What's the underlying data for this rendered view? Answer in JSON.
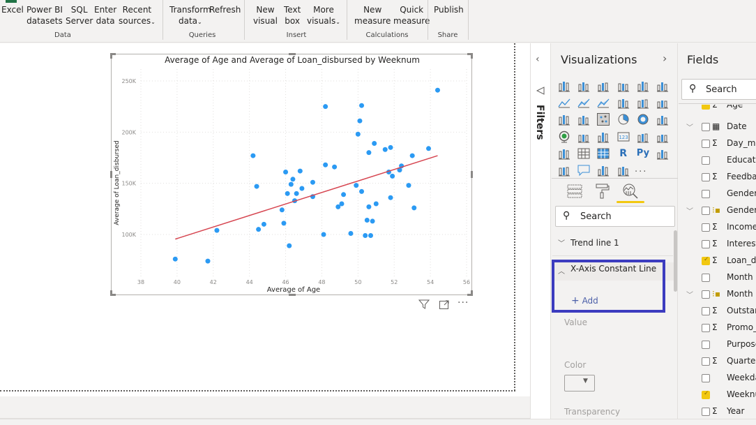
{
  "ribbon": {
    "buttons": [
      {
        "id": "excel",
        "line1": "Excel",
        "line2": ""
      },
      {
        "id": "power-bi-datasets",
        "line1": "Power BI",
        "line2": "datasets"
      },
      {
        "id": "sql-server",
        "line1": "SQL",
        "line2": "Server"
      },
      {
        "id": "enter-data",
        "line1": "Enter",
        "line2": "data"
      },
      {
        "id": "recent-sources",
        "line1": "Recent",
        "line2": "sources"
      },
      {
        "id": "transform-data",
        "line1": "Transform",
        "line2": "data"
      },
      {
        "id": "refresh",
        "line1": "Refresh",
        "line2": ""
      },
      {
        "id": "new-visual",
        "line1": "New",
        "line2": "visual"
      },
      {
        "id": "text-box",
        "line1": "Text",
        "line2": "box"
      },
      {
        "id": "more-visuals",
        "line1": "More",
        "line2": "visuals"
      },
      {
        "id": "new-measure",
        "line1": "New",
        "line2": "measure"
      },
      {
        "id": "quick-measure",
        "line1": "Quick",
        "line2": "measure"
      },
      {
        "id": "publish",
        "line1": "Publish",
        "line2": ""
      }
    ],
    "groups": [
      "Data",
      "Queries",
      "Insert",
      "Calculations",
      "Share"
    ]
  },
  "visual": {
    "footer_icons": [
      "filter-icon",
      "focus-mode-icon",
      "more-options-icon"
    ]
  },
  "chart_data": {
    "type": "scatter",
    "title": "Average of Age and Average of Loan_disbursed by Weeknum",
    "xlabel": "Average of Age",
    "ylabel": "Average of Loan_disbursed",
    "xlim": [
      38,
      56
    ],
    "ylim": [
      65000,
      262000
    ],
    "x_ticks": [
      38,
      40,
      42,
      44,
      46,
      48,
      50,
      52,
      54,
      56
    ],
    "y_ticks": [
      100000,
      150000,
      200000,
      250000
    ],
    "y_tick_labels": [
      "100K",
      "150K",
      "200K",
      "250K"
    ],
    "grid": true,
    "point_color": "#2b9af3",
    "trend_line": {
      "color": "#d64550",
      "from": [
        39.9,
        95500
      ],
      "to": [
        54.4,
        177000
      ]
    },
    "points": [
      [
        39.9,
        76000
      ],
      [
        41.7,
        74000
      ],
      [
        42.2,
        104000
      ],
      [
        44.2,
        177000
      ],
      [
        44.4,
        147000
      ],
      [
        44.5,
        105000
      ],
      [
        44.8,
        110000
      ],
      [
        45.8,
        124000
      ],
      [
        45.9,
        111000
      ],
      [
        46.0,
        161000
      ],
      [
        46.1,
        140000
      ],
      [
        46.2,
        89000
      ],
      [
        46.3,
        149000
      ],
      [
        46.4,
        154000
      ],
      [
        46.5,
        133000
      ],
      [
        46.6,
        140000
      ],
      [
        46.8,
        162000
      ],
      [
        46.9,
        145000
      ],
      [
        47.5,
        151000
      ],
      [
        47.5,
        137000
      ],
      [
        48.1,
        100000
      ],
      [
        48.2,
        225000
      ],
      [
        48.2,
        168000
      ],
      [
        48.7,
        166000
      ],
      [
        48.9,
        127000
      ],
      [
        49.1,
        130000
      ],
      [
        49.2,
        139000
      ],
      [
        49.6,
        101000
      ],
      [
        49.9,
        148000
      ],
      [
        50.0,
        198000
      ],
      [
        50.1,
        211000
      ],
      [
        50.2,
        226000
      ],
      [
        50.2,
        142000
      ],
      [
        50.4,
        99000
      ],
      [
        50.5,
        114000
      ],
      [
        50.6,
        180000
      ],
      [
        50.6,
        127000
      ],
      [
        50.7,
        99000
      ],
      [
        50.8,
        113000
      ],
      [
        50.9,
        189000
      ],
      [
        51.0,
        130000
      ],
      [
        51.5,
        183000
      ],
      [
        51.7,
        161000
      ],
      [
        51.8,
        185000
      ],
      [
        51.8,
        136000
      ],
      [
        51.9,
        157000
      ],
      [
        52.3,
        163000
      ],
      [
        52.4,
        167000
      ],
      [
        52.8,
        148000
      ],
      [
        53.0,
        177000
      ],
      [
        53.1,
        126000
      ],
      [
        53.9,
        184000
      ],
      [
        54.4,
        241000
      ]
    ]
  },
  "filters": {
    "label": "Filters"
  },
  "visualizations": {
    "title": "Visualizations",
    "search_placeholder": "Search",
    "more_label": "...",
    "sections": [
      {
        "label": "Trend line",
        "count": "1",
        "expanded": false
      },
      {
        "label": "X-Axis Constant Line",
        "expanded": true
      }
    ],
    "add_label": "Add",
    "value_label": "Value",
    "color_label": "Color",
    "transparency_label": "Transparency",
    "active_tab_color": "#f2c811"
  },
  "fields": {
    "title": "Fields",
    "search_placeholder": "Search",
    "items": [
      {
        "name": "Age",
        "type": "sigma",
        "checked": true,
        "expandable": false
      },
      {
        "name": "Date",
        "type": "calendar",
        "checked": false,
        "expandable": true
      },
      {
        "name": "Day_month",
        "type": "sigma",
        "checked": false,
        "expandable": false
      },
      {
        "name": "Education",
        "type": "",
        "checked": false,
        "expandable": false
      },
      {
        "name": "Feedback",
        "type": "sigma",
        "checked": false,
        "expandable": false
      },
      {
        "name": "Gender",
        "type": "",
        "checked": false,
        "expandable": false
      },
      {
        "name": "Gender Hierarchy",
        "type": "hierarchy",
        "checked": false,
        "expandable": true
      },
      {
        "name": "Income",
        "type": "sigma",
        "checked": false,
        "expandable": false
      },
      {
        "name": "Interest_rate",
        "type": "sigma",
        "checked": false,
        "expandable": false
      },
      {
        "name": "Loan_disbursed",
        "type": "sigma",
        "checked": true,
        "expandable": false
      },
      {
        "name": "Month",
        "type": "",
        "checked": false,
        "expandable": false
      },
      {
        "name": "Month Hierarchy",
        "type": "hierarchy",
        "checked": false,
        "expandable": true
      },
      {
        "name": "Outstanding",
        "type": "sigma",
        "checked": false,
        "expandable": false
      },
      {
        "name": "Promo_",
        "type": "sigma",
        "checked": false,
        "expandable": false
      },
      {
        "name": "Purpose",
        "type": "",
        "checked": false,
        "expandable": false
      },
      {
        "name": "Quarter",
        "type": "sigma",
        "checked": false,
        "expandable": false
      },
      {
        "name": "Weekday",
        "type": "",
        "checked": false,
        "expandable": false
      },
      {
        "name": "Weeknum",
        "type": "",
        "checked": true,
        "expandable": false
      },
      {
        "name": "Year",
        "type": "sigma",
        "checked": false,
        "expandable": false
      }
    ]
  }
}
